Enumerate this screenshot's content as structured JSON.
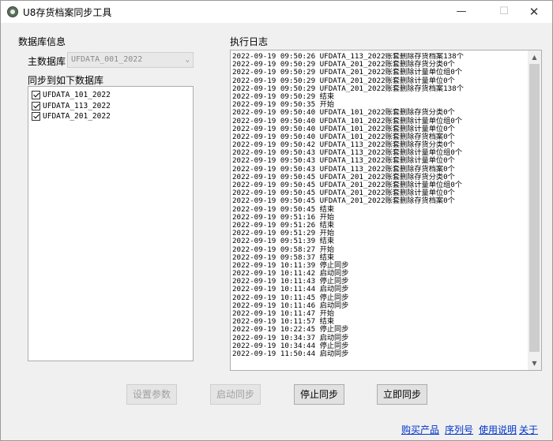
{
  "window": {
    "title": "U8存货档案同步工具",
    "minimize_glyph": "—",
    "maximize_glyph": "☐",
    "close_glyph": "✕"
  },
  "db_info": {
    "group_label": "数据库信息",
    "main_db_label": "主数据库",
    "main_db_value": "UFDATA_001_2022",
    "sync_to_label": "同步到如下数据库",
    "targets": [
      {
        "name": "UFDATA_101_2022",
        "checked": true
      },
      {
        "name": "UFDATA_113_2022",
        "checked": true
      },
      {
        "name": "UFDATA_201_2022",
        "checked": true
      }
    ]
  },
  "log": {
    "label": "执行日志",
    "lines": [
      "2022-09-19 09:50:26 UFDATA_113_2022账套删除存货档案138个",
      "2022-09-19 09:50:29 UFDATA_201_2022账套删除存货分类0个",
      "2022-09-19 09:50:29 UFDATA_201_2022账套删除计量单位组0个",
      "2022-09-19 09:50:29 UFDATA_201_2022账套删除计量单位0个",
      "2022-09-19 09:50:29 UFDATA_201_2022账套删除存货档案138个",
      "2022-09-19 09:50:29 结束",
      "2022-09-19 09:50:35 开始",
      "2022-09-19 09:50:40 UFDATA_101_2022账套删除存货分类0个",
      "2022-09-19 09:50:40 UFDATA_101_2022账套删除计量单位组0个",
      "2022-09-19 09:50:40 UFDATA_101_2022账套删除计量单位0个",
      "2022-09-19 09:50:40 UFDATA_101_2022账套删除存货档案0个",
      "2022-09-19 09:50:42 UFDATA_113_2022账套删除存货分类0个",
      "2022-09-19 09:50:43 UFDATA_113_2022账套删除计量单位组0个",
      "2022-09-19 09:50:43 UFDATA_113_2022账套删除计量单位0个",
      "2022-09-19 09:50:43 UFDATA_113_2022账套删除存货档案0个",
      "2022-09-19 09:50:45 UFDATA_201_2022账套删除存货分类0个",
      "2022-09-19 09:50:45 UFDATA_201_2022账套删除计量单位组0个",
      "2022-09-19 09:50:45 UFDATA_201_2022账套删除计量单位0个",
      "2022-09-19 09:50:45 UFDATA_201_2022账套删除存货档案0个",
      "2022-09-19 09:50:45 结束",
      "2022-09-19 09:51:16 开始",
      "2022-09-19 09:51:26 结束",
      "2022-09-19 09:51:29 开始",
      "2022-09-19 09:51:39 结束",
      "2022-09-19 09:58:27 开始",
      "2022-09-19 09:58:37 结束",
      "2022-09-19 10:11:39 停止同步",
      "2022-09-19 10:11:42 启动同步",
      "2022-09-19 10:11:43 停止同步",
      "2022-09-19 10:11:44 启动同步",
      "2022-09-19 10:11:45 停止同步",
      "2022-09-19 10:11:46 启动同步",
      "2022-09-19 10:11:47 开始",
      "2022-09-19 10:11:57 结束",
      "2022-09-19 10:22:45 停止同步",
      "2022-09-19 10:34:37 启动同步",
      "2022-09-19 10:34:44 停止同步",
      "2022-09-19 11:50:44 启动同步"
    ]
  },
  "buttons": {
    "settings": "设置参数",
    "start_sync": "启动同步",
    "stop_sync": "停止同步",
    "sync_now": "立即同步"
  },
  "footer_links": {
    "buy": "购买产品",
    "serial": "序列号",
    "help": "使用说明",
    "about": "关于"
  },
  "icons": {
    "scroll_up": "▲",
    "scroll_down": "▼",
    "combo_arrow": "⌄"
  }
}
